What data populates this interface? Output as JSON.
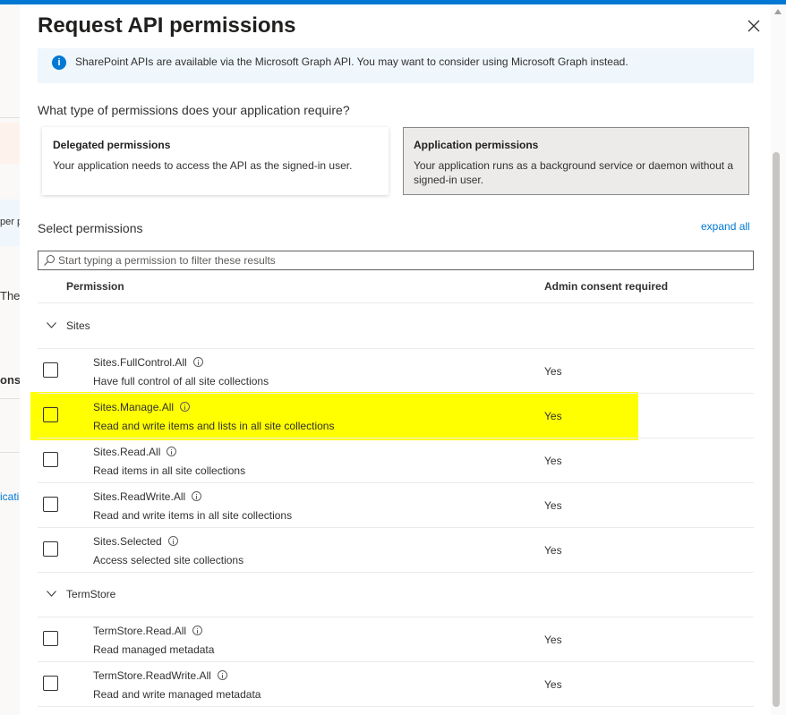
{
  "background_fragments": {
    "frag1": "per p",
    "frag2": "The",
    "frag3": "onse",
    "frag4": "icati"
  },
  "dialog": {
    "title": "Request API permissions",
    "close_icon": "close-icon"
  },
  "info_bar": {
    "icon": "info-icon",
    "text": "SharePoint APIs are available via the Microsoft Graph API.  You may want to consider using Microsoft Graph instead."
  },
  "permission_type": {
    "question": "What type of permissions does your application require?",
    "delegated": {
      "title": "Delegated permissions",
      "description": "Your application needs to access the API as the signed-in user."
    },
    "application": {
      "title": "Application permissions",
      "description": "Your application runs as a background service or daemon without a signed-in user.",
      "selected": true
    }
  },
  "select_permissions": {
    "label": "Select permissions",
    "expand_all": "expand all",
    "search_placeholder": "Start typing a permission to filter these results",
    "search_value": ""
  },
  "table": {
    "col_permission": "Permission",
    "col_admin": "Admin consent required",
    "groups": [
      {
        "name": "Sites",
        "expanded": true,
        "items": [
          {
            "name": "Sites.FullControl.All",
            "description": "Have full control of all site collections",
            "admin": "Yes",
            "checked": false
          },
          {
            "name": "Sites.Manage.All",
            "description": "Read and write items and lists in all site collections",
            "admin": "Yes",
            "checked": false,
            "highlighted": true
          },
          {
            "name": "Sites.Read.All",
            "description": "Read items in all site collections",
            "admin": "Yes",
            "checked": false
          },
          {
            "name": "Sites.ReadWrite.All",
            "description": "Read and write items in all site collections",
            "admin": "Yes",
            "checked": false
          },
          {
            "name": "Sites.Selected",
            "description": "Access selected site collections",
            "admin": "Yes",
            "checked": false
          }
        ]
      },
      {
        "name": "TermStore",
        "expanded": true,
        "items": [
          {
            "name": "TermStore.Read.All",
            "description": "Read managed metadata",
            "admin": "Yes",
            "checked": false
          },
          {
            "name": "TermStore.ReadWrite.All",
            "description": "Read and write managed metadata",
            "admin": "Yes",
            "checked": false
          }
        ]
      }
    ]
  },
  "colors": {
    "accent": "#0078d4",
    "highlight": "#ffff00",
    "selected_card_bg": "#edebe9"
  }
}
